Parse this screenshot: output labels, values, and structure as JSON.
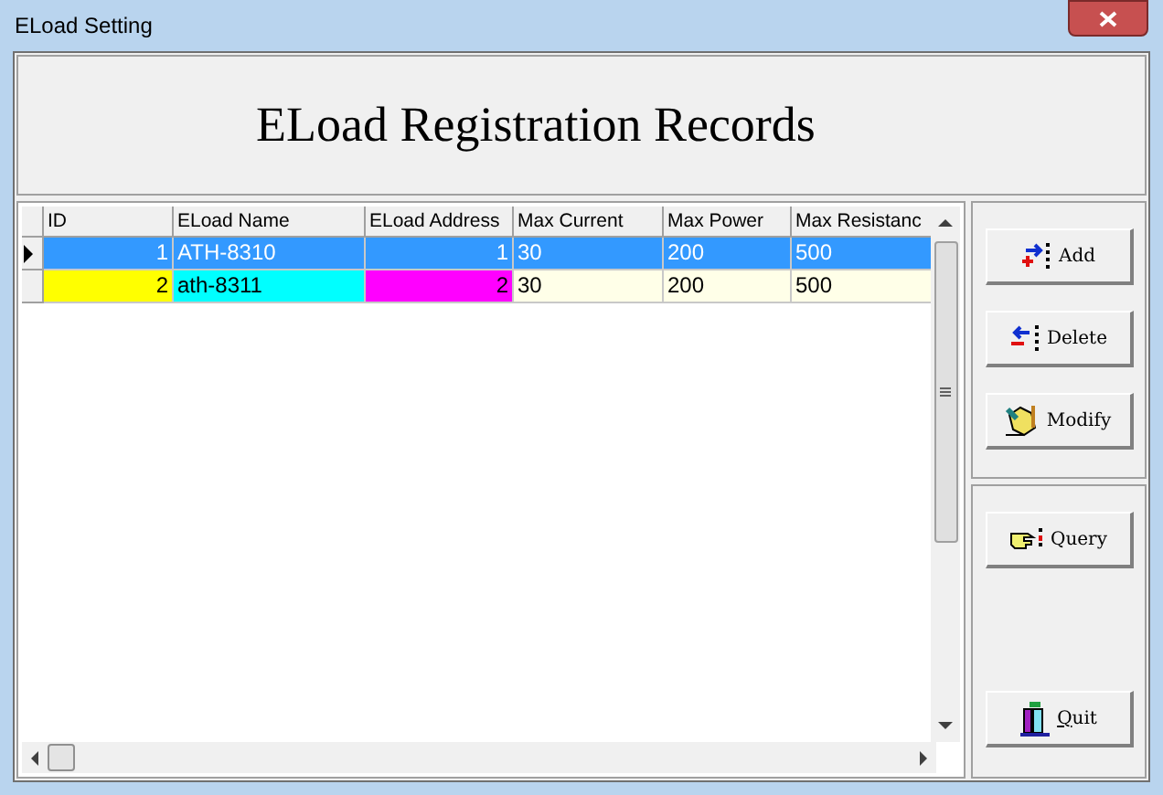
{
  "window": {
    "title": "ELoad Setting"
  },
  "header": {
    "title": "ELoad Registration Records"
  },
  "table": {
    "columns": [
      {
        "label": "ID",
        "kind": "number"
      },
      {
        "label": "ELoad Name",
        "kind": "text"
      },
      {
        "label": "ELoad Address",
        "kind": "number"
      },
      {
        "label": "Max Current",
        "kind": "text"
      },
      {
        "label": "Max Power",
        "kind": "text"
      },
      {
        "label": "Max Resistanc",
        "kind": "text"
      }
    ],
    "rows": [
      {
        "selected": true,
        "cells": [
          {
            "text": "1"
          },
          {
            "text": "ATH-8310"
          },
          {
            "text": "1"
          },
          {
            "text": "30"
          },
          {
            "text": "200"
          },
          {
            "text": "500"
          }
        ]
      },
      {
        "selected": false,
        "cells": [
          {
            "text": "2",
            "color": "#ffff00"
          },
          {
            "text": "ath-8311",
            "color": "#00ffff"
          },
          {
            "text": "2",
            "color": "#ff00ff"
          },
          {
            "text": "30"
          },
          {
            "text": "200"
          },
          {
            "text": "500"
          }
        ]
      }
    ]
  },
  "button_groups": [
    [
      {
        "label": "Add",
        "kind": "add",
        "accelerator": false
      },
      {
        "label": "Delete",
        "kind": "delete",
        "accelerator": false
      },
      {
        "label": "Modify",
        "kind": "modify",
        "accelerator": false
      }
    ],
    [
      {
        "label": "Query",
        "kind": "query",
        "accelerator": false
      },
      {
        "label": "Quit",
        "kind": "quit",
        "accelerator": true
      }
    ]
  ]
}
